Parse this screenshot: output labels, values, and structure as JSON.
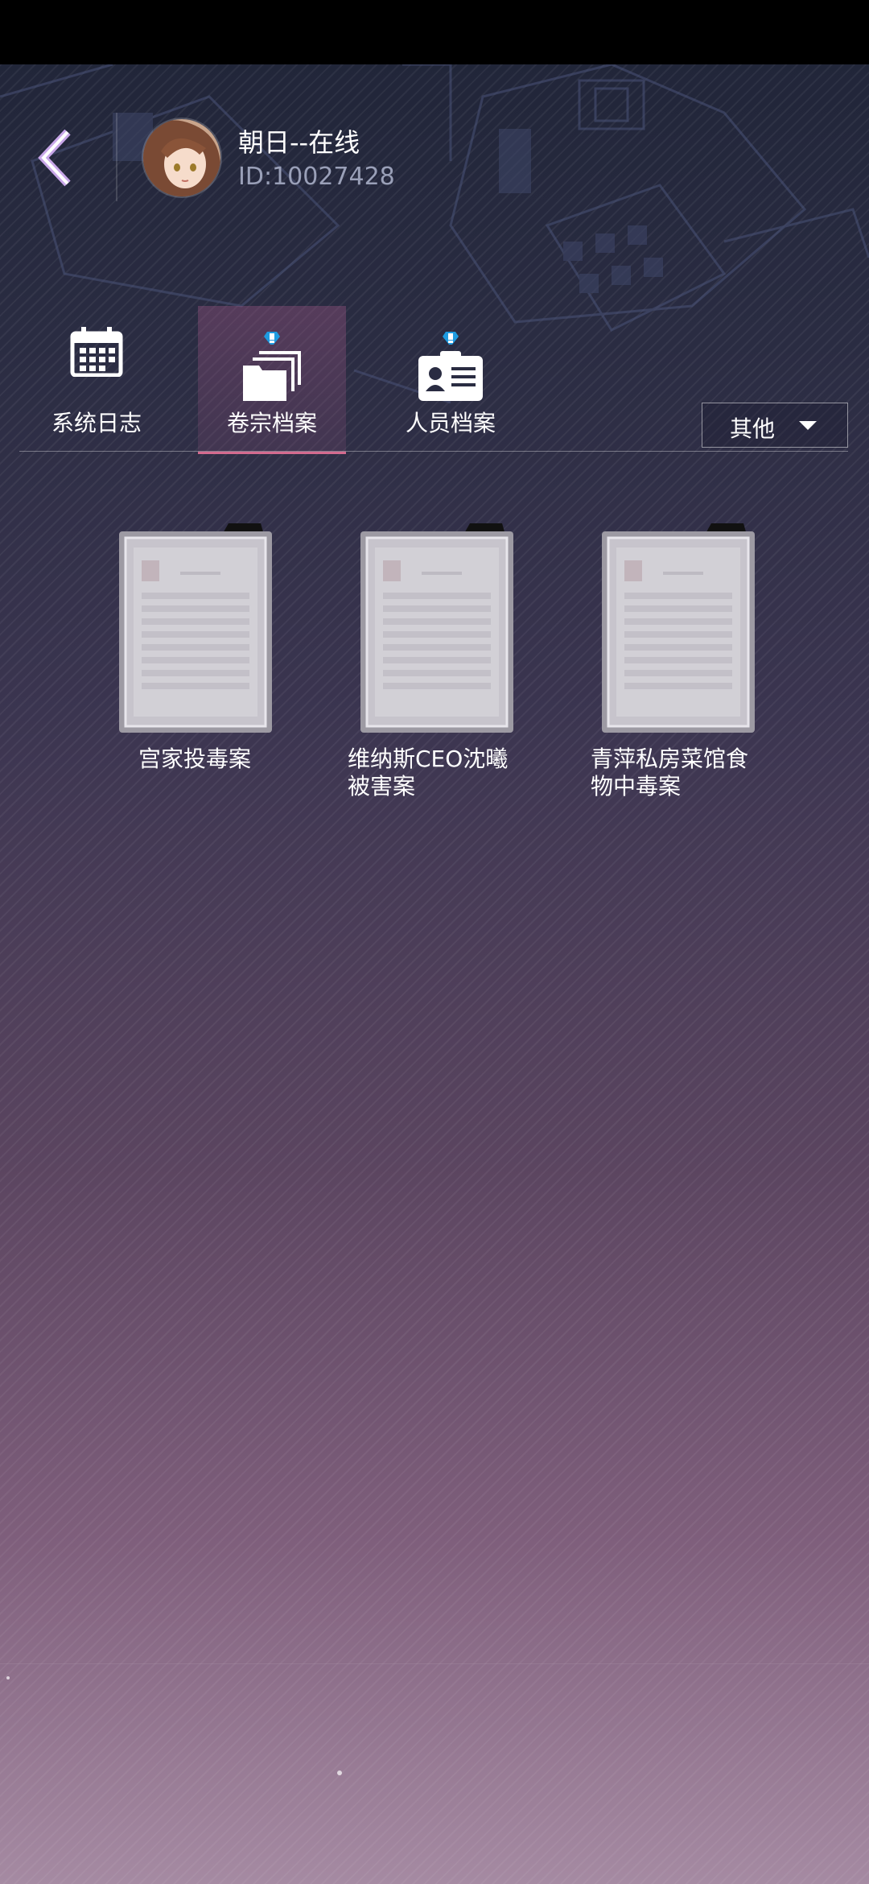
{
  "user": {
    "name": "朝日--在线",
    "id_text": "ID:10027428"
  },
  "tabs": [
    {
      "label": "系统日志",
      "icon": "calendar-icon",
      "active": false,
      "alert": false
    },
    {
      "label": "卷宗档案",
      "icon": "folders-icon",
      "active": true,
      "alert": true
    },
    {
      "label": "人员档案",
      "icon": "id-card-icon",
      "active": false,
      "alert": true
    }
  ],
  "filter": {
    "selected": "其他"
  },
  "cases": [
    {
      "title": "宫家投毒案"
    },
    {
      "title": "维纳斯CEO沈曦被害案"
    },
    {
      "title": "青萍私房菜馆食物中毒案"
    }
  ],
  "colors": {
    "accent": "#d46b8f",
    "alert": "#1e9be0"
  }
}
